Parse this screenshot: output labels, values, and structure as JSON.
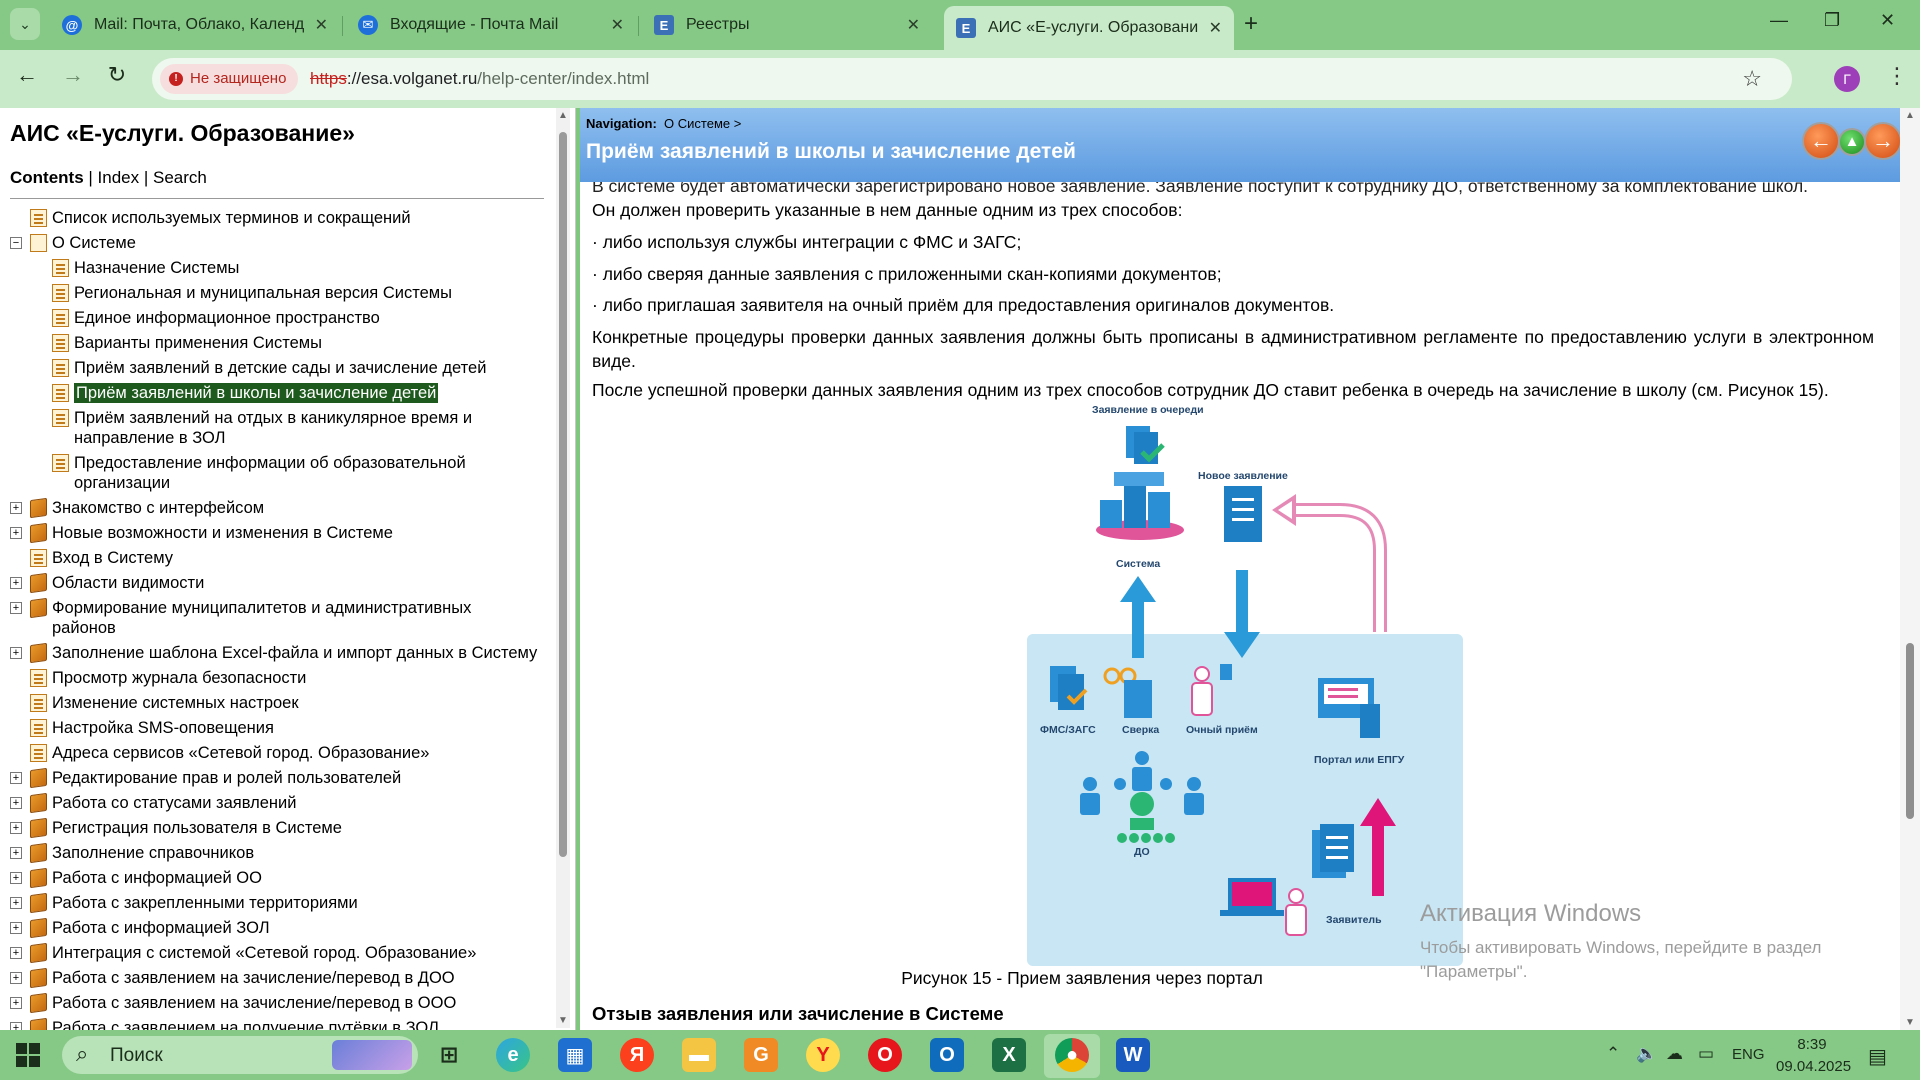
{
  "browser": {
    "tabs": [
      {
        "title": "Mail: Почта, Облако, Календар",
        "favicon": "@",
        "color": "#1e6fd9"
      },
      {
        "title": "Входящие - Почта Mail",
        "favicon": "✉",
        "color": "#1e6fd9"
      },
      {
        "title": "Реестры",
        "favicon": "E",
        "color": "#3b6fb6"
      },
      {
        "title": "АИС «Е-услуги. Образование»",
        "favicon": "E",
        "color": "#3b6fb6"
      }
    ],
    "security_label": "Не защищено",
    "url_protocol": "https",
    "url_host": "://esa.volganet.ru",
    "url_path": "/help-center/index.html",
    "profile_initial": "Г"
  },
  "help": {
    "title": "АИС «Е-услуги. Образование»",
    "tabs": {
      "contents": "Contents",
      "sep1": " | ",
      "index": "Index",
      "sep2": " |  ",
      "search": "Search"
    },
    "tree": [
      {
        "label": "Список используемых терминов и сокращений",
        "level": 0,
        "icon": "page",
        "expander": ""
      },
      {
        "label": "О Системе",
        "level": 0,
        "icon": "openbook",
        "expander": "−"
      },
      {
        "label": "Назначение Системы",
        "level": 1,
        "icon": "page",
        "expander": ""
      },
      {
        "label": "Региональная и муниципальная версия Системы",
        "level": 1,
        "icon": "page",
        "expander": ""
      },
      {
        "label": "Единое информационное пространство",
        "level": 1,
        "icon": "page",
        "expander": ""
      },
      {
        "label": "Варианты применения Системы",
        "level": 1,
        "icon": "page",
        "expander": ""
      },
      {
        "label": "Приём заявлений в детские сады и зачисление детей",
        "level": 1,
        "icon": "page",
        "expander": ""
      },
      {
        "label": "Приём заявлений в школы и зачисление детей",
        "level": 1,
        "icon": "page",
        "expander": "",
        "selected": true
      },
      {
        "label": "Приём заявлений на отдых в каникулярное время и",
        "label2": "направление в ЗОЛ",
        "level": 1,
        "icon": "page",
        "expander": ""
      },
      {
        "label": "Предоставление информации об образовательной",
        "label2": "организации",
        "level": 1,
        "icon": "page",
        "expander": ""
      },
      {
        "label": "Знакомство с интерфейсом",
        "level": 0,
        "icon": "book",
        "expander": "+"
      },
      {
        "label": "Новые возможности и изменения в Системе",
        "level": 0,
        "icon": "book",
        "expander": "+"
      },
      {
        "label": "Вход в Систему",
        "level": 0,
        "icon": "page",
        "expander": ""
      },
      {
        "label": "Области видимости",
        "level": 0,
        "icon": "book",
        "expander": "+"
      },
      {
        "label": "Формирование муниципалитетов и административных",
        "label2": "районов",
        "level": 0,
        "icon": "book",
        "expander": "+"
      },
      {
        "label": "Заполнение шаблона Excel-файла и импорт данных в Систему",
        "level": 0,
        "icon": "book",
        "expander": "+"
      },
      {
        "label": "Просмотр журнала безопасности",
        "level": 0,
        "icon": "page",
        "expander": ""
      },
      {
        "label": "Изменение системных настроек",
        "level": 0,
        "icon": "page",
        "expander": ""
      },
      {
        "label": "Настройка SMS-оповещения",
        "level": 0,
        "icon": "page",
        "expander": ""
      },
      {
        "label": "Адреса сервисов «Сетевой город. Образование»",
        "level": 0,
        "icon": "page",
        "expander": ""
      },
      {
        "label": "Редактирование прав и ролей пользователей",
        "level": 0,
        "icon": "book",
        "expander": "+"
      },
      {
        "label": "Работа со статусами заявлений",
        "level": 0,
        "icon": "book",
        "expander": "+"
      },
      {
        "label": "Регистрация пользователя в Системе",
        "level": 0,
        "icon": "book",
        "expander": "+"
      },
      {
        "label": "Заполнение справочников",
        "level": 0,
        "icon": "book",
        "expander": "+"
      },
      {
        "label": "Работа с информацией ОО",
        "level": 0,
        "icon": "book",
        "expander": "+"
      },
      {
        "label": "Работа с закрепленными территориями",
        "level": 0,
        "icon": "book",
        "expander": "+"
      },
      {
        "label": "Работа с информацией ЗОЛ",
        "level": 0,
        "icon": "book",
        "expander": "+"
      },
      {
        "label": "Интеграция с системой «Сетевой город. Образование»",
        "level": 0,
        "icon": "book",
        "expander": "+"
      },
      {
        "label": "Работа с заявлением на зачисление/перевод в ДОО",
        "level": 0,
        "icon": "book",
        "expander": "+"
      },
      {
        "label": "Работа с заявлением на зачисление/перевод в ООО",
        "level": 0,
        "icon": "book",
        "expander": "+"
      },
      {
        "label": "Работа с заявлением на получение путёвки в ЗОЛ",
        "level": 0,
        "icon": "book",
        "expander": "+"
      }
    ]
  },
  "content": {
    "nav_label": "Navigation:",
    "nav_path": "О Системе >",
    "title": "Приём заявлений в школы и зачисление детей",
    "clipped_line": "В системе будет автоматически зарегистрировано новое заявление. Заявление поступит к сотруднику ДО, ответственному за комплектование школ.",
    "p1": "Он должен проверить указанные в нем данные одним из трех способов:",
    "bullets": [
      "·  либо используя службы интеграции с ФМС и ЗАГС;",
      "· либо сверяя данные заявления с приложенными скан-копиями документов;",
      "· либо приглашая заявителя на очный приём для предоставления оригиналов документов."
    ],
    "p2": "Конкретные процедуры проверки данных заявления должны быть прописаны в административном регламенте по предоставлению услуги в электронном виде.",
    "p3": "После успешной проверки данных заявления одним из трех способов сотрудник ДО ставит ребенка в очередь на зачисление в школу (см. Рисунок 15).",
    "figure": {
      "labels": {
        "queue": "Заявление в очереди",
        "new": "Новое заявление",
        "system": "Система",
        "fms": "ФМС/ЗАГС",
        "check": "Сверка",
        "visit": "Очный приём",
        "portal": "Портал или ЕПГУ",
        "do": "ДО",
        "applicant": "Заявитель"
      },
      "caption": "Рисунок 15 - Прием заявления через портал"
    },
    "next_heading": "Отзыв заявления или зачисление в Системе"
  },
  "watermark": {
    "line1": "Активация Windows",
    "line2": "Чтобы активировать Windows, перейдите в раздел",
    "line3": "\"Параметры\"."
  },
  "taskbar": {
    "search_placeholder": "Поиск",
    "lang": "ENG",
    "time": "8:39",
    "date": "09.04.2025"
  }
}
